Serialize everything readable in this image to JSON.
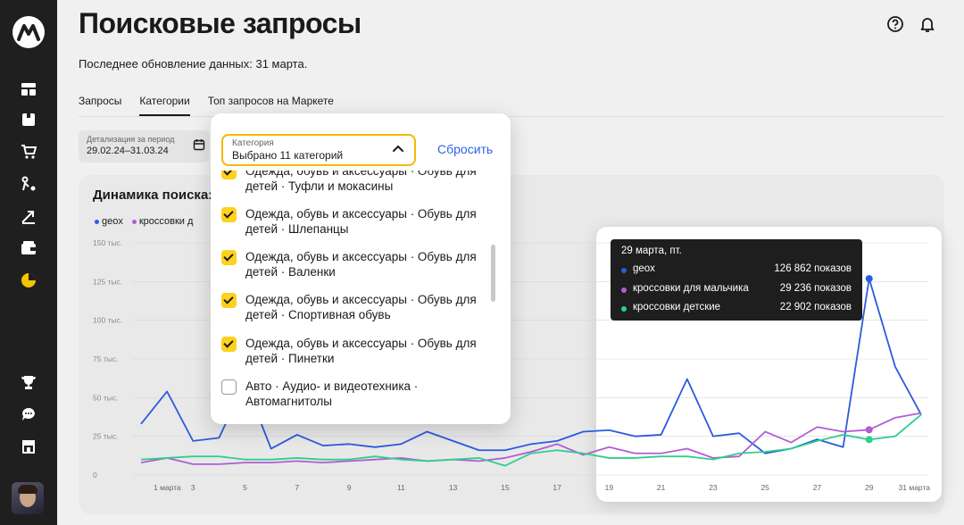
{
  "page": {
    "title": "Поисковые запросы",
    "updated": "Последнее обновление данных: 31 марта."
  },
  "tabs": [
    {
      "label": "Запросы"
    },
    {
      "label": "Категории"
    },
    {
      "label": "Топ запросов на Маркете"
    }
  ],
  "period": {
    "label": "Детализация за период",
    "value": "29.02.24–31.03.24"
  },
  "card": {
    "title": "Динамика поиска:"
  },
  "legend": [
    {
      "name": "geox",
      "color": "#2b5bde"
    },
    {
      "name": "кроссовки д",
      "color": "#b25cd6"
    }
  ],
  "popup": {
    "select_label": "Категория",
    "select_value": "Выбрано 11 категорий",
    "reset_label": "Сбросить",
    "items": [
      {
        "label": "Одежда, обувь и аксессуары · Обувь для детей · Туфли и мокасины",
        "checked": true
      },
      {
        "label": "Одежда, обувь и аксессуары · Обувь для детей · Шлепанцы",
        "checked": true
      },
      {
        "label": "Одежда, обувь и аксессуары · Обувь для детей · Валенки",
        "checked": true
      },
      {
        "label": "Одежда, обувь и аксессуары · Обувь для детей · Спортивная обувь",
        "checked": true
      },
      {
        "label": "Одежда, обувь и аксессуары · Обувь для детей · Пинетки",
        "checked": true
      },
      {
        "label": "Авто · Аудио- и видеотехника · Автомагнитолы",
        "checked": false
      }
    ]
  },
  "tooltip": {
    "date": "29 марта, пт.",
    "rows": [
      {
        "name": "geox",
        "value": "126 862 показов",
        "color": "#2b5bde"
      },
      {
        "name": "кроссовки для мальчика",
        "value": "29 236 показов",
        "color": "#b25cd6"
      },
      {
        "name": "кроссовки детские",
        "value": "22 902 показов",
        "color": "#2fcf8c"
      }
    ]
  },
  "chart_data": {
    "type": "line",
    "ylabels": [
      "150 тыс.",
      "125 тыс.",
      "100 тыс.",
      "75 тыс.",
      "50 тыс.",
      "25 тыс.",
      "0"
    ],
    "y_ticks": [
      150000,
      125000,
      100000,
      75000,
      50000,
      25000,
      0
    ],
    "ylim": [
      0,
      150000
    ],
    "x": [
      1,
      2,
      3,
      4,
      5,
      6,
      7,
      8,
      9,
      10,
      11,
      12,
      13,
      14,
      15,
      16,
      17,
      18,
      19,
      20,
      21,
      22,
      23,
      24,
      25,
      26,
      27,
      28,
      29,
      30,
      31
    ],
    "x_tick_labels": [
      {
        "x": 1,
        "label": "1 марта"
      },
      {
        "x": 3,
        "label": "3"
      },
      {
        "x": 5,
        "label": "5"
      },
      {
        "x": 7,
        "label": "7"
      },
      {
        "x": 9,
        "label": "9"
      },
      {
        "x": 11,
        "label": "11"
      },
      {
        "x": 13,
        "label": "13"
      },
      {
        "x": 15,
        "label": "15"
      },
      {
        "x": 17,
        "label": "17"
      },
      {
        "x": 19,
        "label": "19"
      },
      {
        "x": 21,
        "label": "21"
      },
      {
        "x": 23,
        "label": "23"
      },
      {
        "x": 25,
        "label": "25"
      },
      {
        "x": 27,
        "label": "27"
      },
      {
        "x": 29,
        "label": "29"
      },
      {
        "x": 31,
        "label": "31 марта"
      }
    ],
    "series": [
      {
        "name": "geox",
        "color": "#2b5bde",
        "values": [
          33000,
          54000,
          22000,
          24000,
          60000,
          17000,
          26000,
          19000,
          20000,
          18000,
          20000,
          28000,
          22000,
          16000,
          16000,
          20000,
          22000,
          28000,
          29000,
          25000,
          26000,
          62000,
          25000,
          27000,
          14000,
          17000,
          23000,
          18000,
          126862,
          70000,
          39000
        ]
      },
      {
        "name": "кроссовки для мальчика",
        "color": "#b25cd6",
        "values": [
          8000,
          11000,
          7000,
          7000,
          8000,
          8000,
          9000,
          8000,
          9000,
          10000,
          11000,
          9000,
          10000,
          9000,
          11000,
          15000,
          20000,
          13000,
          18000,
          14000,
          14000,
          17000,
          11000,
          12000,
          28000,
          21000,
          31000,
          28000,
          29236,
          37000,
          40000
        ]
      },
      {
        "name": "кроссовки детские",
        "color": "#2fcf8c",
        "values": [
          10000,
          11000,
          12000,
          12000,
          10000,
          10000,
          11000,
          10000,
          10000,
          12000,
          10000,
          9000,
          10000,
          11000,
          6000,
          14000,
          16000,
          14000,
          11000,
          11000,
          12000,
          12000,
          10000,
          14000,
          15000,
          17000,
          22000,
          26000,
          22902,
          25000,
          39000
        ]
      }
    ],
    "highlight_x": 29,
    "grid": true
  }
}
